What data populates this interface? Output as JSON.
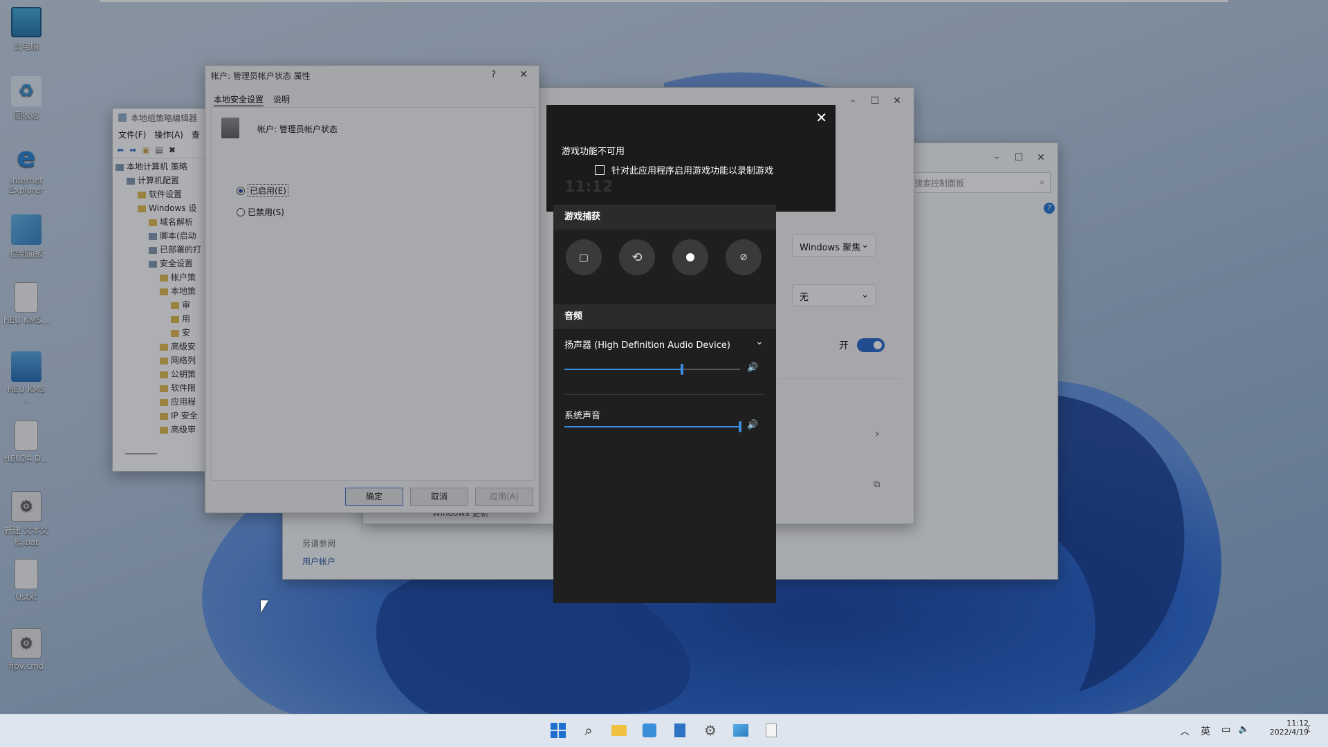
{
  "desktop_icons": [
    {
      "label": "此电脑",
      "icon": "computer-icon"
    },
    {
      "label": "回收站",
      "icon": "recycle-bin-icon"
    },
    {
      "label": "Internet Explorer",
      "icon": "internet-explorer-icon"
    },
    {
      "label": "控制面板",
      "icon": "control-panel-icon"
    },
    {
      "label": "HEU KMS...",
      "icon": "file-icon"
    },
    {
      "label": "HEU KMS ...",
      "icon": "package-icon"
    },
    {
      "label": "HEU24 D...",
      "icon": "file-icon"
    },
    {
      "label": "新建 文本文档.bat",
      "icon": "batch-file-icon"
    },
    {
      "label": "Ustxt",
      "icon": "text-file-icon"
    },
    {
      "label": "fipv.cmd",
      "icon": "batch-file-icon"
    }
  ],
  "gpedit": {
    "title": "本地组策略编辑器",
    "menu": [
      "文件(F)",
      "操作(A)",
      "查"
    ],
    "tree": [
      {
        "label": "本地计算机 策略",
        "indent": 0,
        "icon": "computer-icon"
      },
      {
        "label": "计算机配置",
        "indent": 1,
        "icon": "computer-icon"
      },
      {
        "label": "软件设置",
        "indent": 2,
        "icon": "folder-icon"
      },
      {
        "label": "Windows 设",
        "indent": 2,
        "icon": "folder-icon"
      },
      {
        "label": "域名解析",
        "indent": 3,
        "icon": "folder-icon"
      },
      {
        "label": "脚本(启动",
        "indent": 3,
        "icon": "script-icon"
      },
      {
        "label": "已部署的打",
        "indent": 3,
        "icon": "printer-icon"
      },
      {
        "label": "安全设置",
        "indent": 3,
        "icon": "security-icon"
      },
      {
        "label": "帐户策",
        "indent": 4,
        "icon": "folder-icon"
      },
      {
        "label": "本地策",
        "indent": 4,
        "icon": "folder-icon"
      },
      {
        "label": "审",
        "indent": 5,
        "icon": "folder-icon"
      },
      {
        "label": "用",
        "indent": 5,
        "icon": "folder-icon"
      },
      {
        "label": "安",
        "indent": 5,
        "icon": "folder-icon"
      },
      {
        "label": "高级安",
        "indent": 4,
        "icon": "folder-icon"
      },
      {
        "label": "网络列",
        "indent": 4,
        "icon": "folder-icon"
      },
      {
        "label": "公钥策",
        "indent": 4,
        "icon": "folder-icon"
      },
      {
        "label": "软件限",
        "indent": 4,
        "icon": "folder-icon"
      },
      {
        "label": "应用程",
        "indent": 4,
        "icon": "folder-icon"
      },
      {
        "label": "IP 安全",
        "indent": 4,
        "icon": "folder-icon"
      },
      {
        "label": "高级审",
        "indent": 4,
        "icon": "folder-icon"
      }
    ]
  },
  "props_dialog": {
    "title": "帐户: 管理员帐户状态 属性",
    "help": "?",
    "close": "✕",
    "tabs": [
      "本地安全设置",
      "说明"
    ],
    "policy_name": "帐户: 管理员帐户状态",
    "radio_enabled": "已启用(E)",
    "radio_disabled": "已禁用(S)",
    "ok": "确定",
    "cancel": "取消",
    "apply": "应用(A)"
  },
  "control_panel": {
    "search_placeholder": "搜索控制面板",
    "see_also": "另请参阅",
    "user_accounts": "用户帐户",
    "windows_update": "Windows 更新"
  },
  "settings": {
    "dropdown1": "Windows 聚焦",
    "dropdown2": "无",
    "toggle_label": "开",
    "toggle_on": true
  },
  "gamebar": {
    "unavailable_title": "游戏功能不可用",
    "checkbox_label": "针对此应用程序启用游戏功能以录制游戏",
    "time_ghost": "11:12",
    "capture_header": "游戏捕获",
    "audio_header": "音频",
    "device": "扬声器 (High Definition Audio Device)",
    "device_volume": 0.67,
    "system_sound": "系统声音",
    "system_volume": 1.0,
    "capture_buttons": [
      {
        "name": "screenshot-icon",
        "glyph": "◙"
      },
      {
        "name": "record-last-icon",
        "glyph": "⟲"
      },
      {
        "name": "record-icon",
        "glyph": "●"
      },
      {
        "name": "mic-off-icon",
        "glyph": "🎙"
      }
    ]
  },
  "taskbar": {
    "lang": "英",
    "time": "11:12",
    "date": "2022/4/19"
  }
}
